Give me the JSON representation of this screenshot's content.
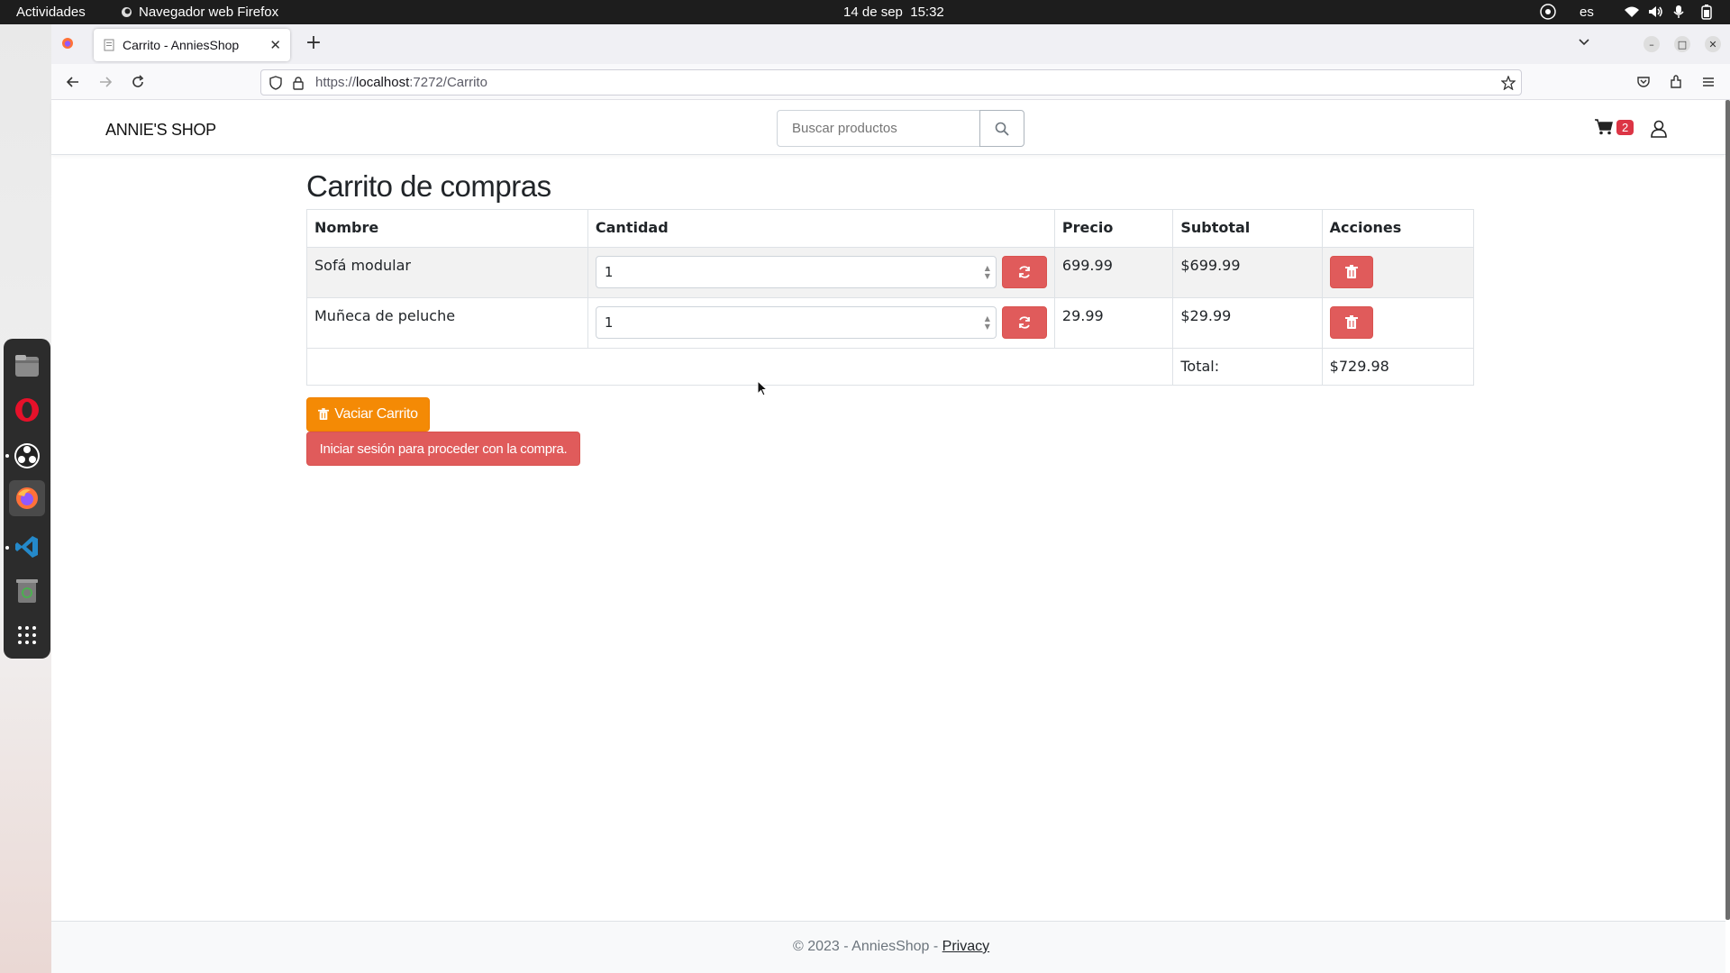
{
  "system": {
    "activities": "Actividades",
    "app_name": "Navegador web Firefox",
    "date": "14 de sep",
    "time": "15:32",
    "lang": "es"
  },
  "browser": {
    "tab_title": "Carrito - AnniesShop",
    "url_prefix": "https://",
    "url_host": "localhost",
    "url_rest": ":7272/Carrito"
  },
  "site": {
    "brand": "ANNIE'S SHOP",
    "search_placeholder": "Buscar productos",
    "cart_count": "2"
  },
  "cart": {
    "title": "Carrito de compras",
    "headers": {
      "name": "Nombre",
      "qty": "Cantidad",
      "price": "Precio",
      "subtotal": "Subtotal",
      "actions": "Acciones"
    },
    "items": [
      {
        "name": "Sofá modular",
        "qty": "1",
        "price": "699.99",
        "subtotal": "$699.99"
      },
      {
        "name": "Muñeca de peluche",
        "qty": "1",
        "price": "29.99",
        "subtotal": "$29.99"
      }
    ],
    "total_label": "Total:",
    "total_value": "$729.98",
    "empty_button": "Vaciar Carrito",
    "login_button": "Iniciar sesión para proceder con la compra."
  },
  "footer": {
    "copyright": "© 2023 - AnniesShop - ",
    "privacy": "Privacy"
  },
  "colors": {
    "danger": "#e05b5b",
    "warning": "#f48a05"
  }
}
